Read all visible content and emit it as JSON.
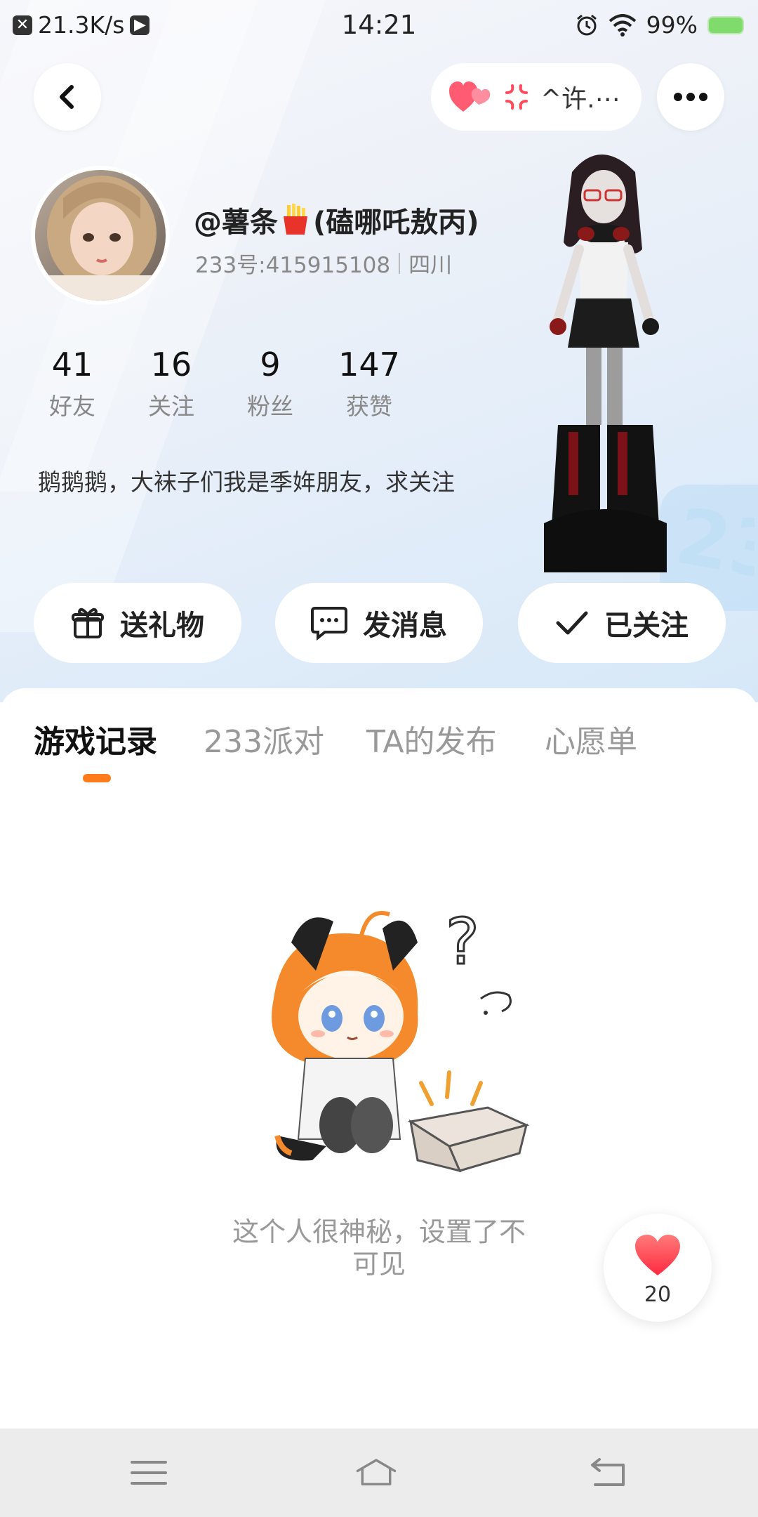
{
  "status_bar": {
    "net_speed": "21.3K/s",
    "time": "14:21",
    "battery": "99%"
  },
  "header": {
    "mood_text": "^许.⋯"
  },
  "profile": {
    "nickname_prefix": "@薯条",
    "nickname_suffix": "(磕哪吒敖丙)",
    "uid": "233号:415915108",
    "region": "四川",
    "bio": "鹅鹅鹅，大袜子们我是季姩朋友，求关注"
  },
  "stats": [
    {
      "value": "41",
      "label": "好友"
    },
    {
      "value": "16",
      "label": "关注"
    },
    {
      "value": "9",
      "label": "粉丝"
    },
    {
      "value": "147",
      "label": "获赞"
    }
  ],
  "actions": {
    "gift": "送礼物",
    "message": "发消息",
    "followed": "已关注"
  },
  "tabs": [
    "游戏记录",
    "233派对",
    "TA的发布",
    "心愿单"
  ],
  "empty_state": {
    "line1": "这个人很神秘，设置了不",
    "line2": "可见"
  },
  "like_fab": {
    "count": "20"
  },
  "colors": {
    "accent": "#ff7a1a",
    "heart": "#ff3b4e"
  }
}
